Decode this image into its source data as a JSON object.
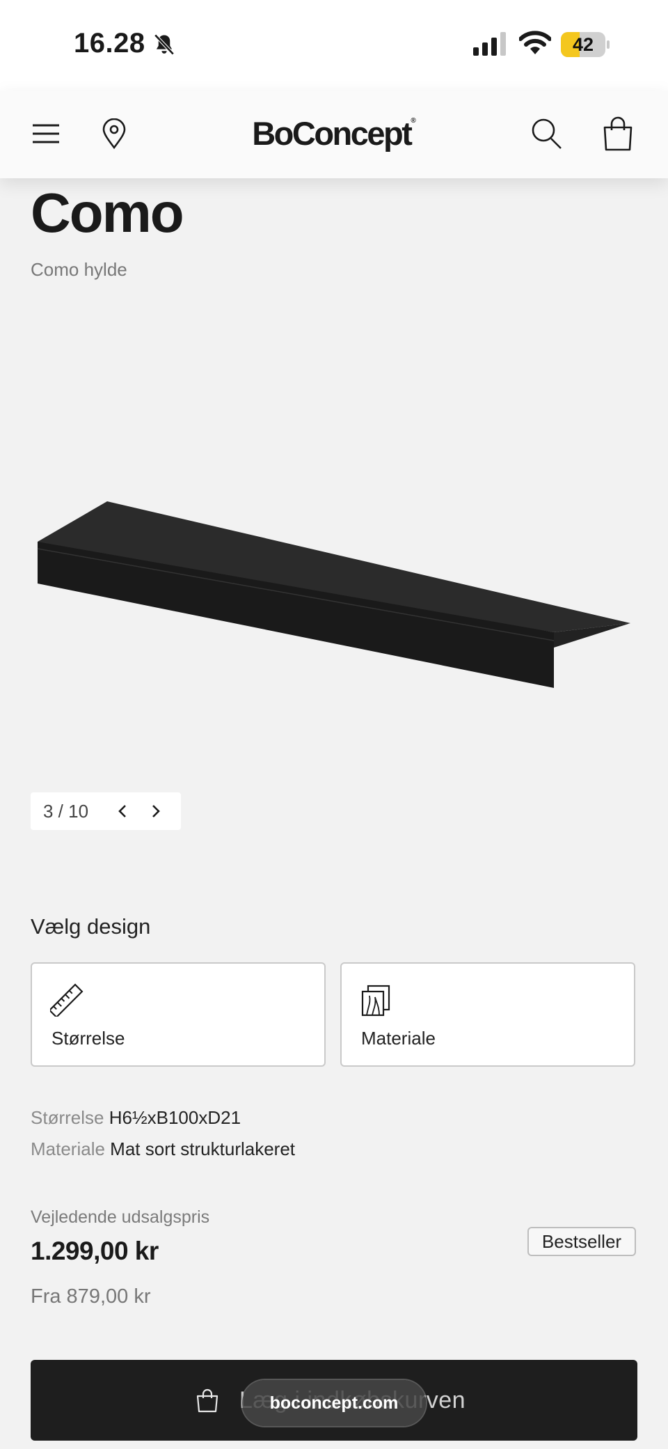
{
  "status_bar": {
    "time": "16.28",
    "battery_level": "42",
    "battery_fraction": 0.42,
    "icons": [
      "bell-slash-icon",
      "cellular-signal-icon",
      "wifi-icon",
      "battery-icon"
    ],
    "battery_color": "#f4c71e"
  },
  "header": {
    "logo": "BoConcept",
    "logo_mark": "®",
    "icons": [
      "menu-icon",
      "location-pin-icon",
      "search-icon",
      "shopping-bag-icon"
    ]
  },
  "product": {
    "title": "Como",
    "subtitle": "Como hylde",
    "image_icon": "black-wall-shelf"
  },
  "gallery": {
    "counter": "3 / 10",
    "current": 3,
    "total": 10
  },
  "design": {
    "heading": "Vælg design",
    "options": [
      {
        "label": "Størrelse",
        "icon": "ruler-icon"
      },
      {
        "label": "Materiale",
        "icon": "material-swatch-icon"
      }
    ]
  },
  "specs": [
    {
      "label": "Størrelse",
      "value": "H6½xB100xD21"
    },
    {
      "label": "Materiale",
      "value": "Mat sort strukturlakeret"
    }
  ],
  "pricing": {
    "label": "Vejledende udsalgspris",
    "price": "1.299,00 kr",
    "from_price": "Fra 879,00 kr",
    "badge": "Bestseller"
  },
  "cta": {
    "label": "Læg i indkøbskurven",
    "icon": "shopping-bag-icon"
  },
  "browser": {
    "url": "boconcept.com"
  },
  "colors": {
    "background": "#f2f2f2",
    "cta_background": "#1e1e1e",
    "header_background": "#fafafa"
  }
}
